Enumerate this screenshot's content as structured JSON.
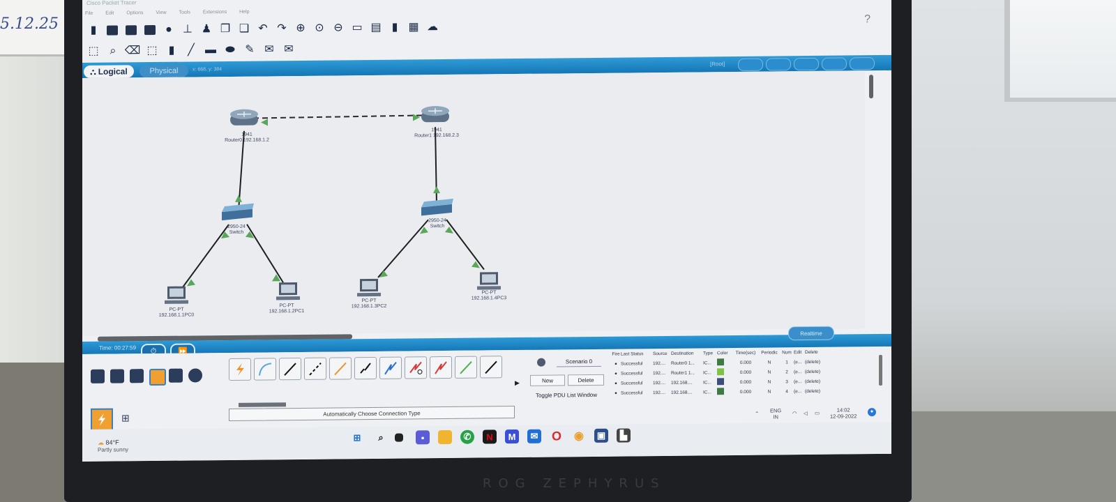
{
  "wall_note": "5.12.25",
  "brand": "ROG ZEPHYRUS",
  "app": {
    "title": "Cisco Packet Tracer",
    "help_label": "?",
    "menu": [
      "File",
      "Edit",
      "Options",
      "View",
      "Tools",
      "Extensions",
      "Help"
    ]
  },
  "workspace": {
    "logical_tab": "Logical",
    "physical_tab": "Physical",
    "coords": "x: 668, y: 384",
    "root_label": "[Root]"
  },
  "topology": {
    "routers": [
      {
        "name": "Router0",
        "model": "1941",
        "label": "Router0 192.168.1.2"
      },
      {
        "name": "Router1",
        "model": "1941",
        "label": "Router1 192.168.2.3"
      }
    ],
    "switches": [
      {
        "model": "2950-24",
        "name": "Switch"
      },
      {
        "model": "2950-24",
        "name": "Switch"
      }
    ],
    "pcs": [
      {
        "type": "PC-PT",
        "label": "192.168.1.1PC0"
      },
      {
        "type": "PC-PT",
        "label": "192.168.1.2PC1"
      },
      {
        "type": "PC-PT",
        "label": "192.168.1.3PC2"
      },
      {
        "type": "PC-PT",
        "label": "192.168.1.4PC3"
      }
    ]
  },
  "sim": {
    "time_label": "Time: 00:27:59",
    "realtime_label": "Realtime"
  },
  "connections": {
    "caption": "Automatically Choose Connection Type"
  },
  "scenario": {
    "selected": "Scenario 0",
    "new_label": "New",
    "delete_label": "Delete",
    "toggle_label": "Toggle PDU List Window"
  },
  "pdu_table": {
    "headers": [
      "Fire",
      "Last Status",
      "Source",
      "Destination",
      "Type",
      "Color",
      "Time(sec)",
      "Periodic",
      "Num",
      "Edit",
      "Delete"
    ],
    "rows": [
      {
        "status": "Successful",
        "source": "192....",
        "destination": "Router0 1...",
        "type": "IC...",
        "color": "#3f7a45",
        "time": "0.000",
        "periodic": "N",
        "num": "1",
        "edit": "(e...",
        "delete": "(delete)"
      },
      {
        "status": "Successful",
        "source": "192....",
        "destination": "Router1 1...",
        "type": "IC...",
        "color": "#7fc244",
        "time": "0.000",
        "periodic": "N",
        "num": "2",
        "edit": "(e...",
        "delete": "(delete)"
      },
      {
        "status": "Successful",
        "source": "192....",
        "destination": "192.168....",
        "type": "IC...",
        "color": "#3c4f7a",
        "time": "0.000",
        "periodic": "N",
        "num": "3",
        "edit": "(e...",
        "delete": "(delete)"
      },
      {
        "status": "Successful",
        "source": "192....",
        "destination": "192.168....",
        "type": "IC...",
        "color": "#3f7a45",
        "time": "0.000",
        "periodic": "N",
        "num": "4",
        "edit": "(e...",
        "delete": "(delete)"
      }
    ]
  },
  "taskbar": {
    "weather_temp": "84°F",
    "weather_desc": "Partly sunny",
    "lang": "ENG",
    "region": "IN",
    "time": "14:02",
    "date": "12-09-2022"
  },
  "colors": {
    "accent_blue": "#1f86c6",
    "link_green": "#5aa65a",
    "selected_orange": "#f0a030"
  }
}
